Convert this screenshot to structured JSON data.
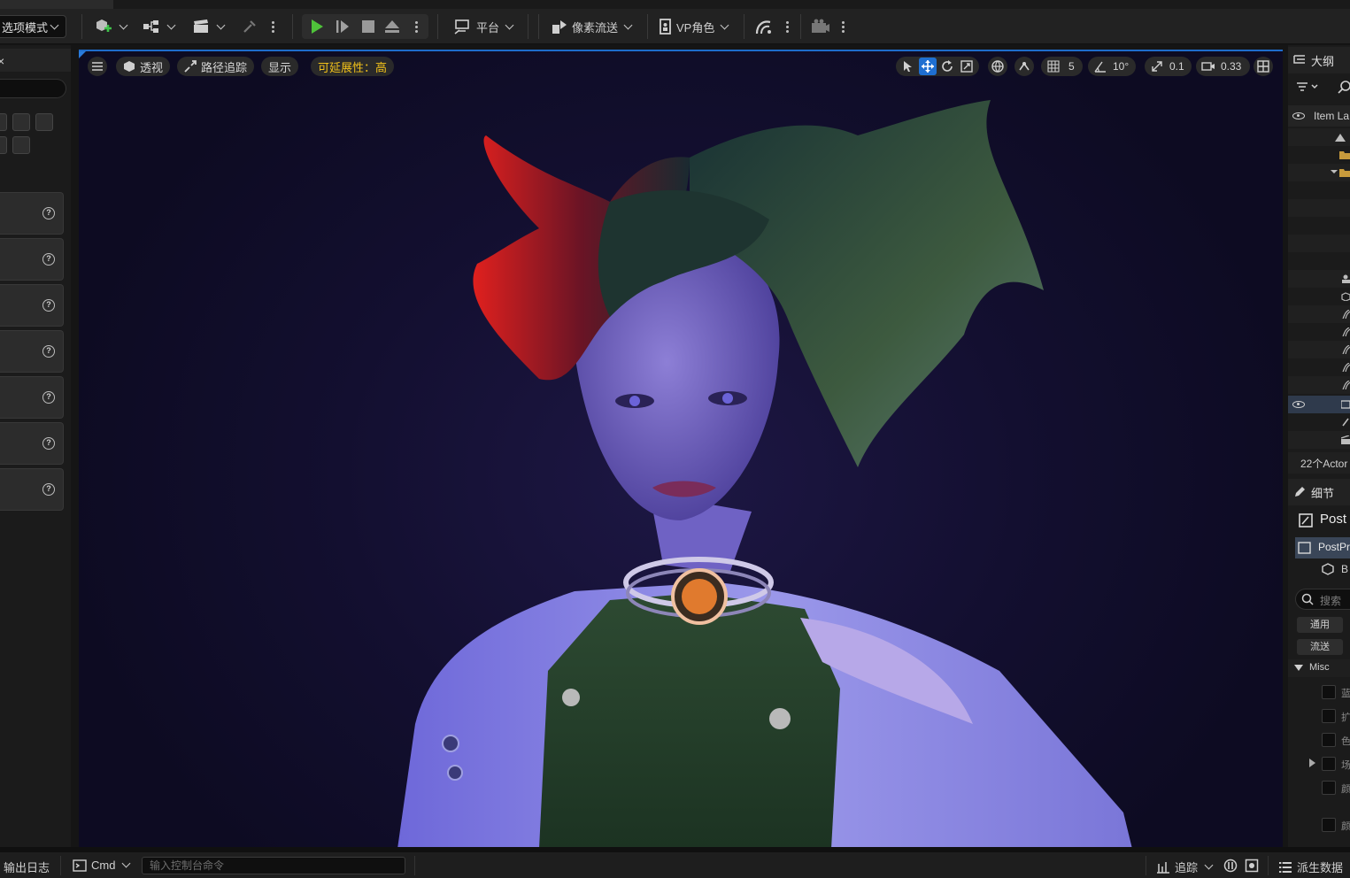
{
  "toolbar": {
    "mode_label": "选项模式",
    "platform_label": "平台",
    "pixel_streaming_label": "像素流送",
    "vp_role_label": "VP角色"
  },
  "viewport": {
    "perspective_label": "透视",
    "path_tracing_label": "路径追踪",
    "show_label": "显示",
    "scalability_label": "可延展性：高",
    "grid_snap_value": "5",
    "rotation_snap_value": "10°",
    "scale_snap_value": "0.1",
    "camera_speed_value": "0.33",
    "accent_color": "#1f6fd1",
    "badge_color": "#f2c21a"
  },
  "outliner": {
    "title": "大纲",
    "column_label": "Item La",
    "actor_count": "22个Actor"
  },
  "details": {
    "title": "细节",
    "object_name": "Post",
    "component_name": "PostPr",
    "sub_component": "B",
    "search_placeholder": "搜索",
    "filter_general": "通用",
    "filter_streaming": "流送",
    "section_misc": "Misc",
    "prop_labels": [
      "蓝",
      "扩",
      "色",
      "场",
      "颜",
      "颜"
    ]
  },
  "statusbar": {
    "output_log": "输出日志",
    "cmd_label": "Cmd",
    "console_placeholder": "输入控制台命令",
    "trace_label": "追踪",
    "derived_data_label": "派生数据"
  }
}
